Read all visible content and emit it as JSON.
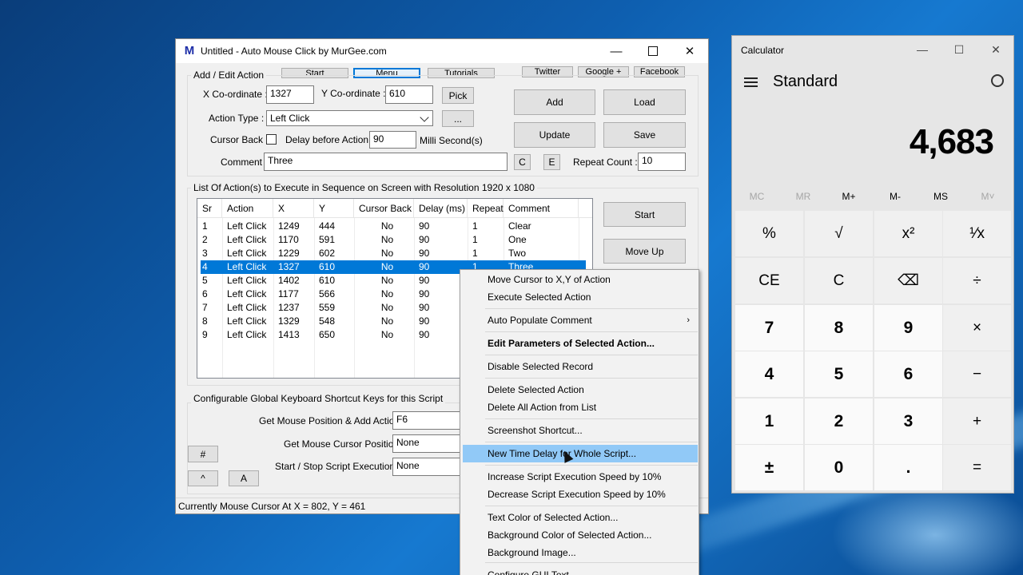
{
  "amc": {
    "title": "Untitled - Auto Mouse Click by MurGee.com",
    "logo_letter": "M",
    "tabs": {
      "start": "Start",
      "menu": "Menu",
      "tutorials": "Tutorials",
      "twitter": "Twitter",
      "google": "Google +",
      "facebook": "Facebook"
    },
    "add_edit": {
      "group_title": "Add / Edit Action",
      "x_label": "X Co-ordinate :",
      "x_value": "1327",
      "y_label": "Y Co-ordinate :",
      "y_value": "610",
      "pick": "Pick",
      "action_type_label": "Action Type :",
      "action_type_value": "Left Click",
      "dots": "...",
      "cursor_back_label": "Cursor Back :",
      "delay_label": "Delay before Action :",
      "delay_value": "90",
      "delay_unit": "Milli Second(s)",
      "comment_label": "Comment :",
      "comment_value": "Three",
      "c_button": "C",
      "e_button": "E",
      "repeat_label": "Repeat Count :",
      "repeat_value": "10"
    },
    "buttons": {
      "add": "Add",
      "load": "Load",
      "update": "Update",
      "save": "Save",
      "start": "Start",
      "move_up": "Move Up"
    },
    "list_title": "List Of Action(s) to Execute in Sequence on Screen with Resolution 1920 x 1080",
    "columns": [
      "Sr",
      "Action",
      "X",
      "Y",
      "Cursor Back",
      "Delay (ms)",
      "Repeat",
      "Comment"
    ],
    "rows": [
      [
        "1",
        "Left Click",
        "1249",
        "444",
        "No",
        "90",
        "1",
        "Clear"
      ],
      [
        "2",
        "Left Click",
        "1170",
        "591",
        "No",
        "90",
        "1",
        "One"
      ],
      [
        "3",
        "Left Click",
        "1229",
        "602",
        "No",
        "90",
        "1",
        "Two"
      ],
      [
        "4",
        "Left Click",
        "1327",
        "610",
        "No",
        "90",
        "1",
        "Three"
      ],
      [
        "5",
        "Left Click",
        "1402",
        "610",
        "No",
        "90",
        "",
        ""
      ],
      [
        "6",
        "Left Click",
        "1177",
        "566",
        "No",
        "90",
        "",
        ""
      ],
      [
        "7",
        "Left Click",
        "1237",
        "559",
        "No",
        "90",
        "",
        ""
      ],
      [
        "8",
        "Left Click",
        "1329",
        "548",
        "No",
        "90",
        "",
        ""
      ],
      [
        "9",
        "Left Click",
        "1413",
        "650",
        "No",
        "90",
        "",
        ""
      ]
    ],
    "selected_row": 4,
    "shortcuts": {
      "group_title": "Configurable Global Keyboard Shortcut Keys for this Script",
      "get_pos_label": "Get Mouse Position & Add Action :",
      "get_pos_value": "F6",
      "cursor_pos_label": "Get Mouse Cursor Position :",
      "cursor_pos_value": "None",
      "start_stop_label": "Start / Stop Script Execution :",
      "start_stop_value": "None",
      "hash": "#",
      "caret": "^",
      "a": "A"
    },
    "status": "Currently Mouse Cursor At X = 802, Y = 461"
  },
  "context_menu": [
    {
      "label": "Move Cursor to X,Y of Action"
    },
    {
      "label": "Execute Selected Action"
    },
    {
      "label": "Auto Populate Comment",
      "submenu": true
    },
    {
      "label": "Edit Parameters of Selected Action...",
      "bold": true
    },
    {
      "label": "Disable Selected Record"
    },
    {
      "label": "Delete Selected Action"
    },
    {
      "label": "Delete All Action from List"
    },
    {
      "label": "Screenshot Shortcut..."
    },
    {
      "label": "New Time Delay for Whole Script...",
      "highlighted": true
    },
    {
      "label": "Increase Script Execution Speed by 10%"
    },
    {
      "label": "Decrease Script Execution Speed by 10%"
    },
    {
      "label": "Text Color of Selected Action..."
    },
    {
      "label": "Background Color of Selected Action..."
    },
    {
      "label": "Background Image..."
    },
    {
      "label": "Configure GUI Text..."
    }
  ],
  "calculator": {
    "title": "Calculator",
    "mode": "Standard",
    "display": "4,683",
    "memory": [
      "MC",
      "MR",
      "M+",
      "M-",
      "MS",
      "M˅"
    ],
    "keys": [
      [
        "%",
        "√",
        "x²",
        "¹⁄x"
      ],
      [
        "CE",
        "C",
        "⌫",
        "÷"
      ],
      [
        "7",
        "8",
        "9",
        "×"
      ],
      [
        "4",
        "5",
        "6",
        "−"
      ],
      [
        "1",
        "2",
        "3",
        "+"
      ],
      [
        "±",
        "0",
        ".",
        "="
      ]
    ]
  }
}
